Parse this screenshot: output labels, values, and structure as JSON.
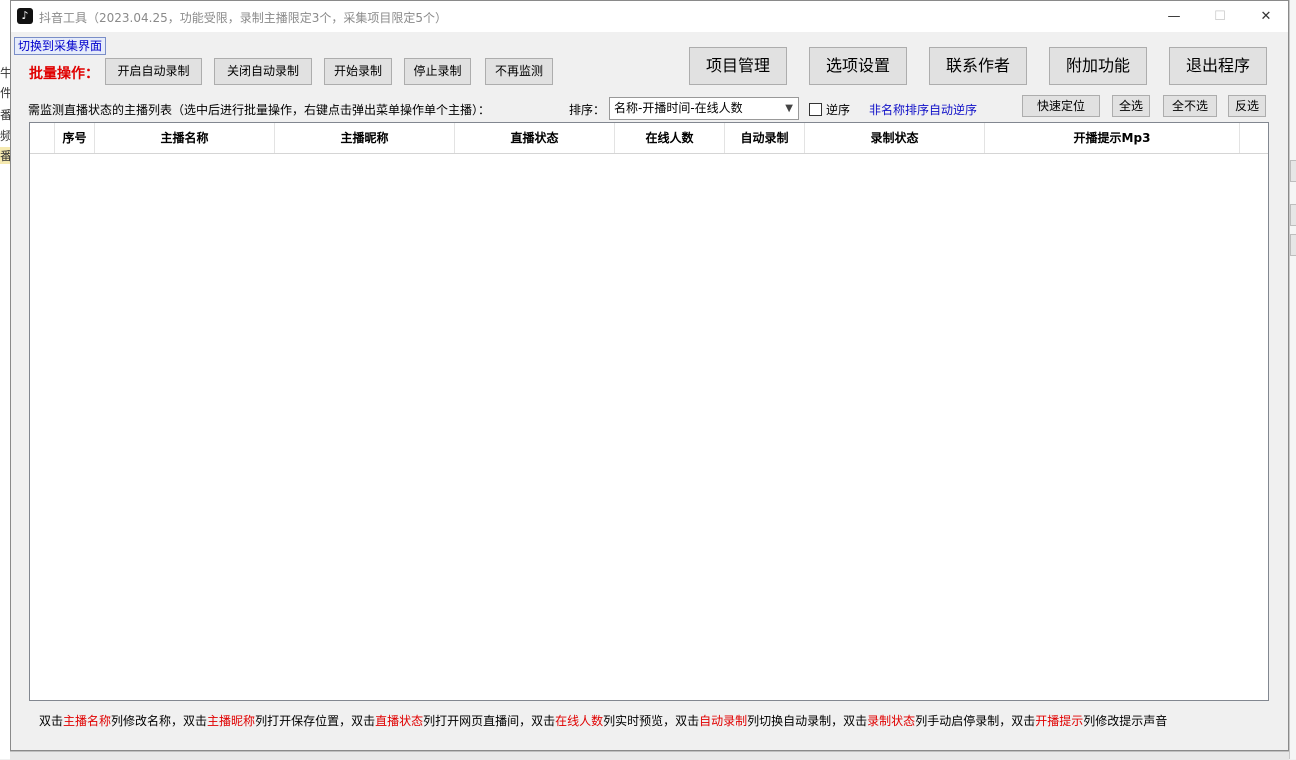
{
  "window": {
    "title": "抖音工具（2023.04.25，功能受限，录制主播限定3个，采集项目限定5个）",
    "minimize": "—",
    "maximize": "☐",
    "close": "✕"
  },
  "background_fragments": [
    "牛",
    "件",
    "番",
    "频",
    "番"
  ],
  "toolbar": {
    "switch_view": "切换到采集界面",
    "batch_label": "批量操作：",
    "batch_buttons": [
      "开启自动录制",
      "关闭自动录制",
      "开始录制",
      "停止录制",
      "不再监测"
    ],
    "main_buttons": [
      "项目管理",
      "选项设置",
      "联系作者",
      "附加功能",
      "退出程序"
    ]
  },
  "list_controls": {
    "caption": "需监测直播状态的主播列表（选中后进行批量操作，右键点击弹出菜单操作单个主播）：",
    "sort_label": "排序：",
    "sort_value": "名称-开播时间-在线人数",
    "reverse_label": "逆序",
    "reverse_checked": false,
    "reverse_note": "非名称排序自动逆序",
    "quick_locate": "快速定位",
    "select_all": "全选",
    "select_none": "全不选",
    "invert_selection": "反选"
  },
  "table": {
    "columns": [
      "",
      "序号",
      "主播名称",
      "主播昵称",
      "直播状态",
      "在线人数",
      "自动录制",
      "录制状态",
      "开播提示Mp3"
    ],
    "rows": []
  },
  "footer": {
    "segments": [
      {
        "text": "双击",
        "color": "black"
      },
      {
        "text": "主播名称",
        "color": "red"
      },
      {
        "text": "列修改名称，双击",
        "color": "black"
      },
      {
        "text": "主播昵称",
        "color": "red"
      },
      {
        "text": "列打开保存位置，双击",
        "color": "black"
      },
      {
        "text": "直播状态",
        "color": "red"
      },
      {
        "text": "列打开网页直播间，双击",
        "color": "black"
      },
      {
        "text": "在线人数",
        "color": "red"
      },
      {
        "text": "列实时预览，双击",
        "color": "black"
      },
      {
        "text": "自动录制",
        "color": "red"
      },
      {
        "text": "列切换自动录制，双击",
        "color": "black"
      },
      {
        "text": "录制状态",
        "color": "red"
      },
      {
        "text": "列手动启停录制，双击",
        "color": "black"
      },
      {
        "text": "开播提示",
        "color": "red"
      },
      {
        "text": "列修改提示声音",
        "color": "black"
      }
    ]
  },
  "colors": {
    "accent_red": "#e00000",
    "link_blue": "#1010c8",
    "window_bg": "#f0f0f0"
  }
}
